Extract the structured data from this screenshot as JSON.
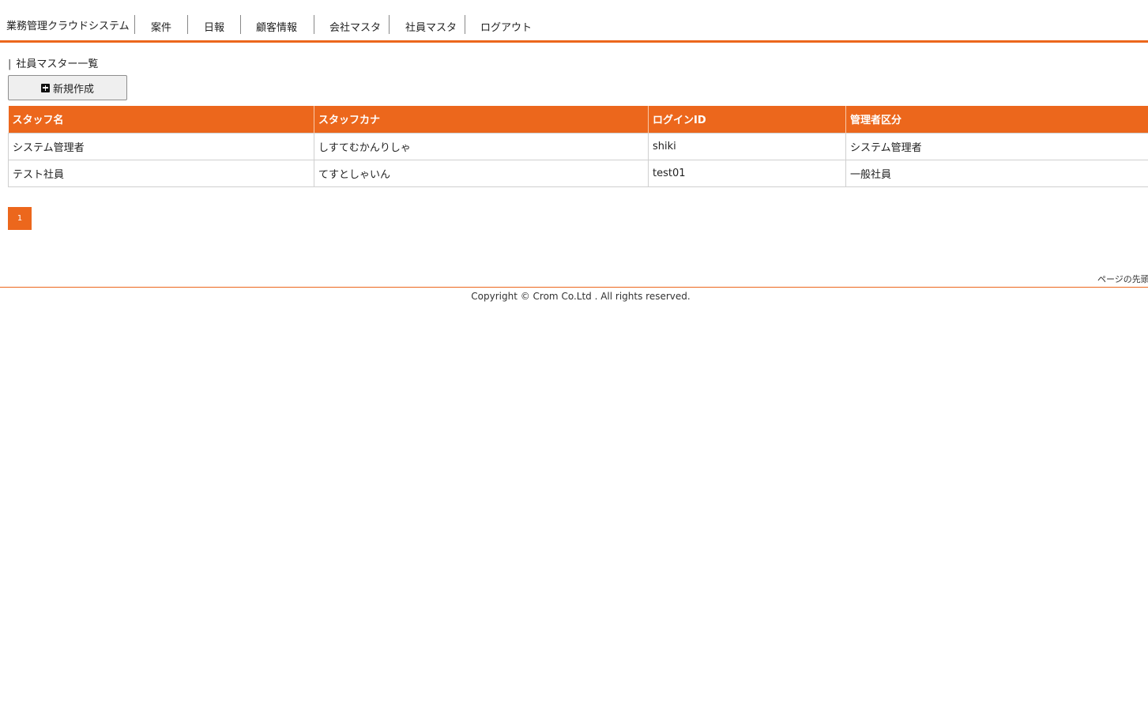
{
  "header": {
    "brand": "業務管理クラウドシステム",
    "nav": [
      {
        "label": "案件"
      },
      {
        "label": "日報"
      },
      {
        "label": "顧客情報"
      },
      {
        "label": "会社マスタ"
      },
      {
        "label": "社員マスタ"
      },
      {
        "label": "ログアウト"
      }
    ]
  },
  "section": {
    "title": "社員マスター一覧",
    "bar": "|"
  },
  "toolbar": {
    "new_label": "新規作成",
    "new_icon": "plus-square-icon"
  },
  "table": {
    "columns": [
      "スタッフ名",
      "スタッフカナ",
      "ログインID",
      "管理者区分"
    ],
    "rows": [
      [
        "システム管理者",
        "しすてむかんりしゃ",
        "shiki",
        "システム管理者"
      ],
      [
        "テスト社員",
        "てすとしゃいん",
        "test01",
        "一般社員"
      ]
    ]
  },
  "pagination": {
    "current": "1"
  },
  "footer": {
    "to_top": "ページの先頭へ",
    "copyright": "Copyright © Crom Co.Ltd . All rights reserved."
  },
  "colors": {
    "accent": "#ec671c"
  }
}
